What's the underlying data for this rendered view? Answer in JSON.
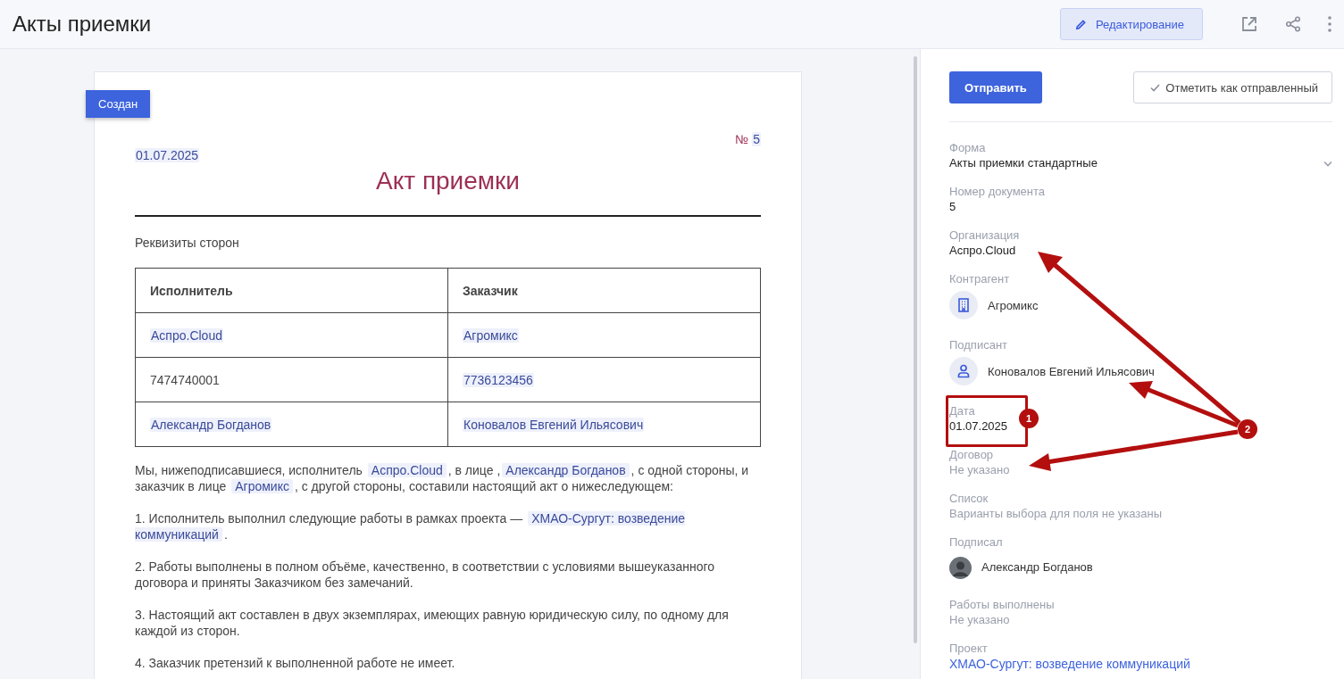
{
  "header": {
    "title": "Акты приемки",
    "edit_button": "Редактирование"
  },
  "document": {
    "status": "Создан",
    "number_label": "№",
    "number": "5",
    "date": "01.07.2025",
    "title": "Акт приемки",
    "requisites_heading": "Реквизиты сторон",
    "table": {
      "columns": [
        "Исполнитель",
        "Заказчик"
      ],
      "rows": [
        [
          {
            "text": "Аспро.Cloud",
            "field": true
          },
          {
            "text": "Агромикс",
            "field": true
          }
        ],
        [
          {
            "text": "7474740001",
            "field": false
          },
          {
            "text": "7736123456",
            "field": true
          }
        ],
        [
          {
            "text": "Александр Богданов",
            "field": true
          },
          {
            "text": "Коновалов Евгений Ильясович",
            "field": true
          }
        ]
      ]
    },
    "paragraphs": [
      [
        {
          "text": "Мы, нижеподписавшиеся, исполнитель ",
          "field": false
        },
        {
          "text": "Аспро.Cloud",
          "field": true
        },
        {
          "text": ", в лице ,",
          "field": false
        },
        {
          "text": "Александр Богданов",
          "field": true
        },
        {
          "text": ", с одной стороны, и заказчик в лице ",
          "field": false
        },
        {
          "text": "Агромикс",
          "field": true
        },
        {
          "text": ", с другой стороны, составили настоящий акт о нижеследующем:",
          "field": false
        }
      ],
      [
        {
          "text": "1. Исполнитель выполнил следующие работы в рамках проекта — ",
          "field": false
        },
        {
          "text": "ХМАО-Сургут: возведение коммуникаций",
          "field": true
        },
        {
          "text": ".",
          "field": false
        }
      ],
      [
        {
          "text": "2. Работы выполнены в полном объёме, качественно, в соответствии с условиями вышеуказанного договора и приняты Заказчиком без замечаний.",
          "field": false
        }
      ],
      [
        {
          "text": "3. Настоящий акт составлен в двух экземплярах, имеющих равную юридическую силу, по одному для каждой из сторон.",
          "field": false
        }
      ],
      [
        {
          "text": "4. Заказчик претензий к выполненной работе не имеет.",
          "field": false
        }
      ]
    ]
  },
  "sidebar": {
    "send_button": "Отправить",
    "mark_sent_button": "Отметить как отправленный",
    "fields": [
      {
        "label": "Форма",
        "value": "Акты приемки стандартные",
        "kind": "select"
      },
      {
        "label": "Номер документа",
        "value": "5",
        "kind": "text"
      },
      {
        "label": "Организация",
        "value": "Аспро.Cloud",
        "kind": "text"
      },
      {
        "label": "Контрагент",
        "value": "Агромикс",
        "kind": "company"
      },
      {
        "label": "Подписант",
        "value": "Коновалов Евгений Ильясович",
        "kind": "person"
      },
      {
        "label": "Дата",
        "value": "01.07.2025",
        "kind": "text"
      },
      {
        "label": "Договор",
        "value": "Не указано",
        "kind": "empty"
      },
      {
        "label": "Список",
        "value": "Варианты выбора для поля не указаны",
        "kind": "empty"
      },
      {
        "label": "Подписал",
        "value": "Александр Богданов",
        "kind": "user"
      },
      {
        "label": "Работы выполнены",
        "value": "Не указано",
        "kind": "empty"
      },
      {
        "label": "Проект",
        "value": "ХМАО-Сургут: возведение коммуникаций",
        "kind": "link"
      }
    ]
  },
  "annotations": [
    {
      "label": "1"
    },
    {
      "label": "2"
    }
  ]
}
